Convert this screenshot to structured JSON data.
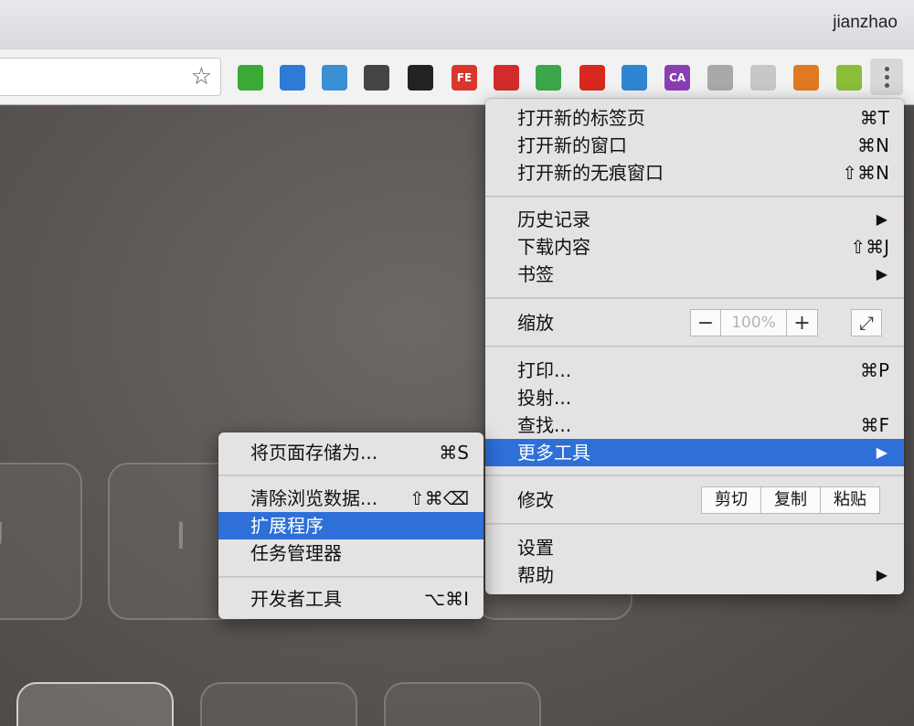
{
  "titlebar": {
    "profile_name": "jianzhao"
  },
  "toolbar": {
    "extensions": [
      {
        "icon": "evernote-icon",
        "label": "",
        "color": "#3aaa36"
      },
      {
        "icon": "reader-icon",
        "label": "",
        "color": "#2d7bd6"
      },
      {
        "icon": "settings-grid-icon",
        "label": "",
        "color": "#3a8fd3"
      },
      {
        "icon": "tampermonkey-icon",
        "label": "",
        "color": "#444444"
      },
      {
        "icon": "qr-code-icon",
        "label": "",
        "color": "#222222"
      },
      {
        "icon": "fe-helper-icon",
        "label": "FE",
        "color": "#d8372b"
      },
      {
        "icon": "video-play-icon",
        "label": "",
        "color": "#d22b2b"
      },
      {
        "icon": "download-arrow-icon",
        "label": "",
        "color": "#3aa84a"
      },
      {
        "icon": "ad-block-icon",
        "label": "",
        "color": "#d9281e"
      },
      {
        "icon": "keyboard-icon",
        "label": "",
        "color": "#2e86d3"
      },
      {
        "icon": "ca-icon",
        "label": "CA",
        "color": "#8a3fb5"
      },
      {
        "icon": "idea-head-icon",
        "label": "",
        "color": "#a9a9a9"
      },
      {
        "icon": "diamond-icon",
        "label": "",
        "color": "#c7c7c7"
      },
      {
        "icon": "fox-icon",
        "label": "",
        "color": "#e07a22"
      },
      {
        "icon": "plant-icon",
        "label": "",
        "color": "#8bbd3a"
      }
    ]
  },
  "main_menu": {
    "new_tab": {
      "label": "打开新的标签页",
      "shortcut": "⌘T"
    },
    "new_window": {
      "label": "打开新的窗口",
      "shortcut": "⌘N"
    },
    "new_incognito": {
      "label": "打开新的无痕窗口",
      "shortcut": "⇧⌘N"
    },
    "history": {
      "label": "历史记录",
      "arrow": "▶"
    },
    "downloads": {
      "label": "下载内容",
      "shortcut": "⇧⌘J"
    },
    "bookmarks": {
      "label": "书签",
      "arrow": "▶"
    },
    "zoom": {
      "label": "缩放",
      "minus": "−",
      "value": "100%",
      "plus": "+",
      "fullscreen": "⤢"
    },
    "print": {
      "label": "打印...",
      "shortcut": "⌘P"
    },
    "cast": {
      "label": "投射..."
    },
    "find": {
      "label": "查找...",
      "shortcut": "⌘F"
    },
    "more_tools": {
      "label": "更多工具",
      "arrow": "▶"
    },
    "edit": {
      "label": "修改",
      "cut": "剪切",
      "copy": "复制",
      "paste": "粘贴"
    },
    "settings": {
      "label": "设置"
    },
    "help": {
      "label": "帮助",
      "arrow": "▶"
    }
  },
  "sub_menu": {
    "save_page": {
      "label": "将页面存储为...",
      "shortcut": "⌘S"
    },
    "clear_data": {
      "label": "清除浏览数据...",
      "shortcut": "⇧⌘⌫"
    },
    "extensions": {
      "label": "扩展程序"
    },
    "task_manager": {
      "label": "任务管理器"
    },
    "dev_tools": {
      "label": "开发者工具",
      "shortcut": "⌥⌘I"
    }
  },
  "background_keys": [
    {
      "glyph": "U"
    },
    {
      "glyph": "I"
    }
  ]
}
